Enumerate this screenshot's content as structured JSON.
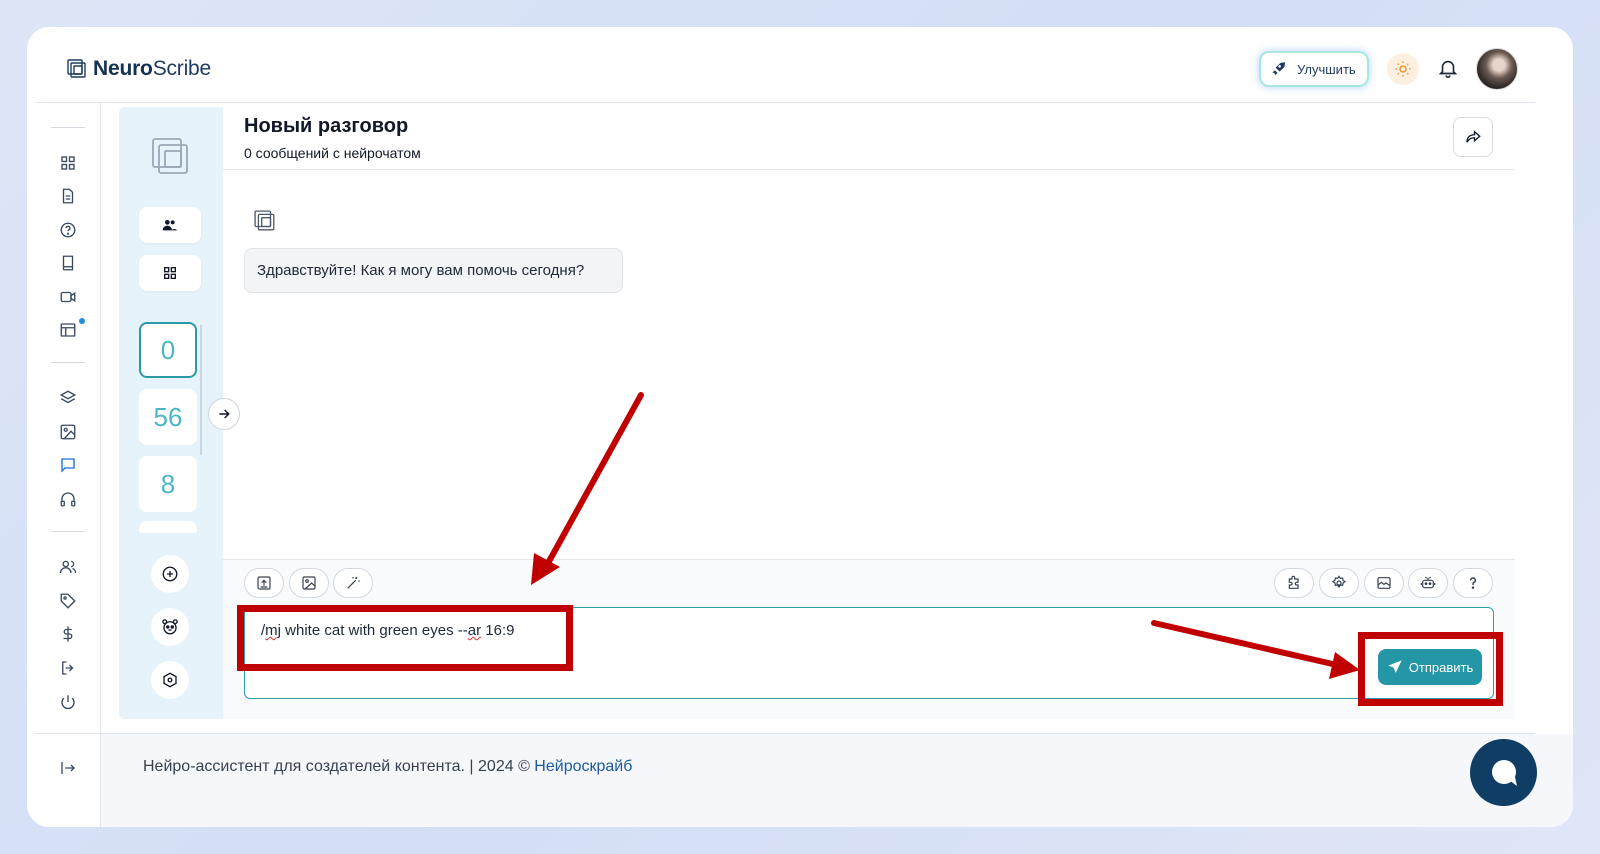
{
  "app": {
    "logo_part1": "Neuro",
    "logo_part2": "Scribe",
    "upgrade_label": "Улучшить"
  },
  "chat": {
    "title": "Новый разговор",
    "subtitle": "0 сообщений с нейрочатом",
    "greeting": "Здравствуйте! Как я могу вам помочь сегодня?"
  },
  "sidebar": {
    "counts": [
      "0",
      "56",
      "8"
    ]
  },
  "composer": {
    "input_prefix": "/",
    "input_mj": "mj",
    "input_mid": " white cat with green eyes --",
    "input_ar": "ar",
    "input_suffix": " 16:9",
    "send_label": "Отправить"
  },
  "footer": {
    "text": "Нейро-ассистент для создателей контента.  | 2024 © ",
    "link": "Нейроскрайб"
  },
  "colors": {
    "accent": "#2596a6",
    "annotation": "#c00000",
    "navy": "#0f3d64"
  }
}
